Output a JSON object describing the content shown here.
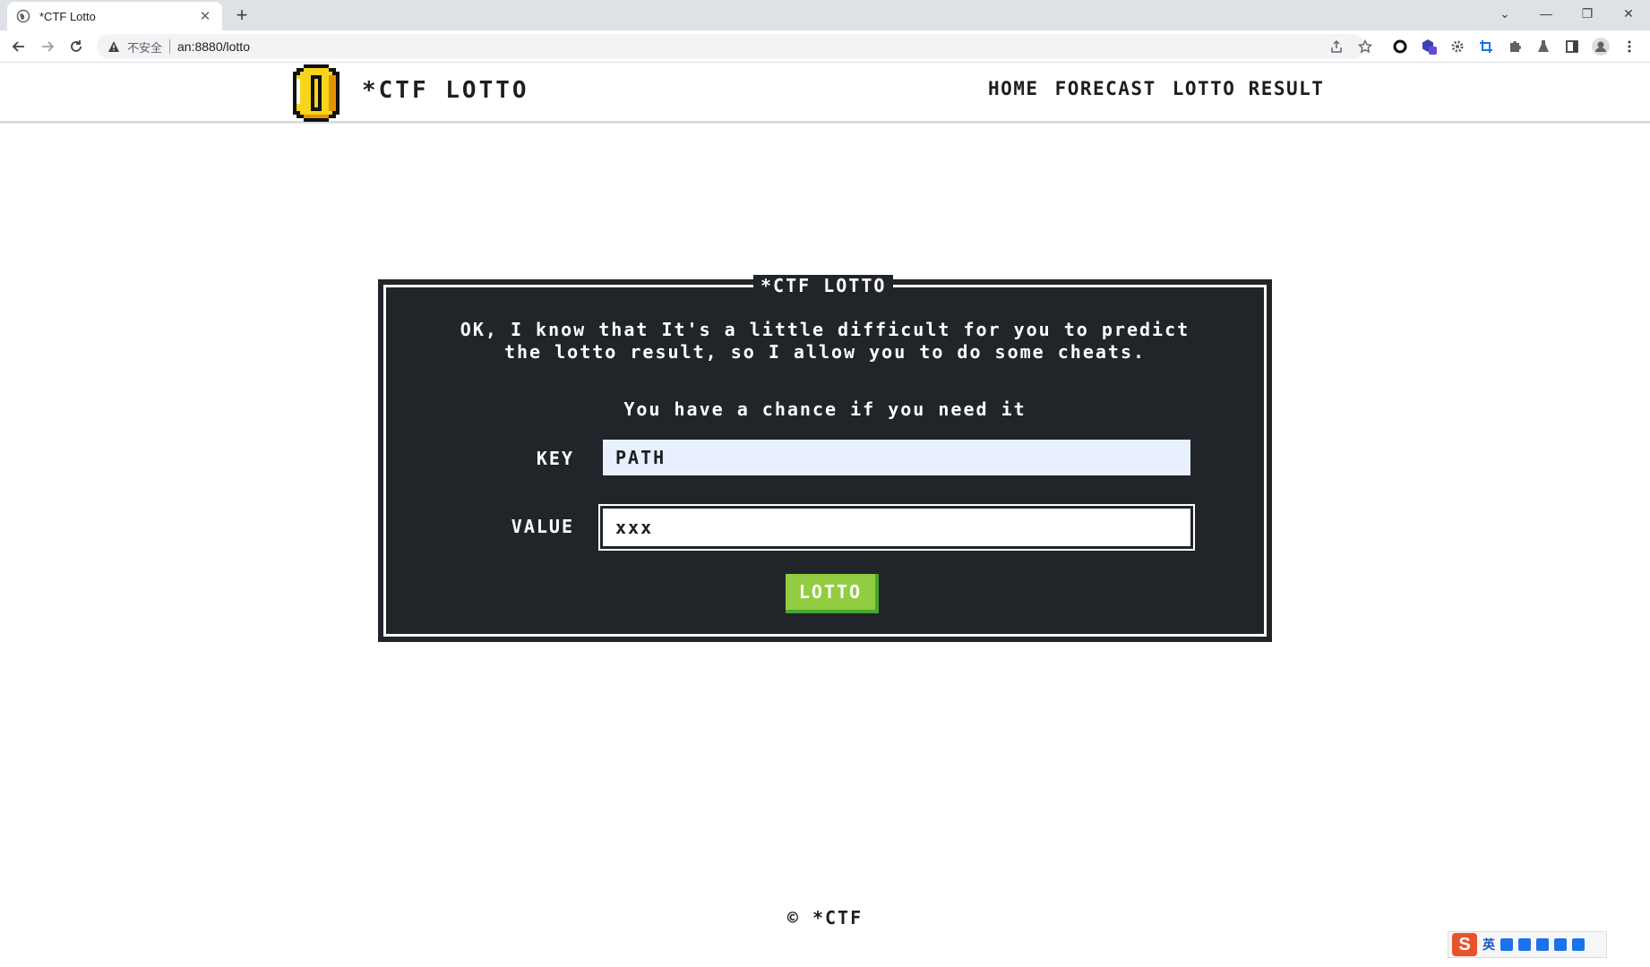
{
  "browser": {
    "tab_title": "*CTF Lotto",
    "tab_close": "✕",
    "new_tab": "+",
    "security_label": "不安全",
    "url": "an:8880/lotto",
    "window_controls": {
      "collapse": "⌄",
      "minimize": "—",
      "restore": "❐",
      "close": "✕"
    }
  },
  "site": {
    "brand": "*CTF LOTTO",
    "nav": [
      "HOME",
      "FORECAST",
      "LOTTO RESULT"
    ]
  },
  "dialog": {
    "title": "*CTF LOTTO",
    "intro_line1": "OK, I know that It's a little difficult for you to predict",
    "intro_line2": "the lotto result, so I allow you to do some cheats.",
    "chance": "You have a chance if you need it",
    "key_label": "KEY",
    "key_value": "PATH",
    "value_label": "VALUE",
    "value_value": "xxx",
    "button": "LOTTO"
  },
  "footer": {
    "copyright": "© *CTF"
  },
  "ime": {
    "logo": "S",
    "mode": "英"
  },
  "colors": {
    "dialog_bg": "#212529",
    "button_green": "#92cc41",
    "button_shadow": "#4aa52e",
    "key_field_bg": "#e8f0fe"
  }
}
